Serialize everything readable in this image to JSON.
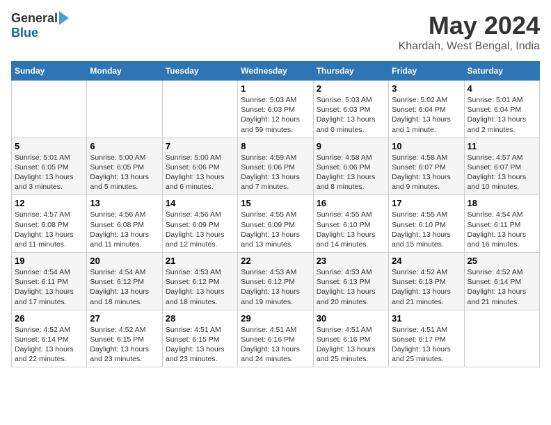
{
  "logo": {
    "general": "General",
    "blue": "Blue"
  },
  "title": {
    "month_year": "May 2024",
    "location": "Khardah, West Bengal, India"
  },
  "headers": [
    "Sunday",
    "Monday",
    "Tuesday",
    "Wednesday",
    "Thursday",
    "Friday",
    "Saturday"
  ],
  "weeks": [
    [
      {
        "day": "",
        "sunrise": "",
        "sunset": "",
        "daylight": ""
      },
      {
        "day": "",
        "sunrise": "",
        "sunset": "",
        "daylight": ""
      },
      {
        "day": "",
        "sunrise": "",
        "sunset": "",
        "daylight": ""
      },
      {
        "day": "1",
        "sunrise": "Sunrise: 5:03 AM",
        "sunset": "Sunset: 6:03 PM",
        "daylight": "Daylight: 12 hours and 59 minutes."
      },
      {
        "day": "2",
        "sunrise": "Sunrise: 5:03 AM",
        "sunset": "Sunset: 6:03 PM",
        "daylight": "Daylight: 13 hours and 0 minutes."
      },
      {
        "day": "3",
        "sunrise": "Sunrise: 5:02 AM",
        "sunset": "Sunset: 6:04 PM",
        "daylight": "Daylight: 13 hours and 1 minute."
      },
      {
        "day": "4",
        "sunrise": "Sunrise: 5:01 AM",
        "sunset": "Sunset: 6:04 PM",
        "daylight": "Daylight: 13 hours and 2 minutes."
      }
    ],
    [
      {
        "day": "5",
        "sunrise": "Sunrise: 5:01 AM",
        "sunset": "Sunset: 6:05 PM",
        "daylight": "Daylight: 13 hours and 3 minutes."
      },
      {
        "day": "6",
        "sunrise": "Sunrise: 5:00 AM",
        "sunset": "Sunset: 6:05 PM",
        "daylight": "Daylight: 13 hours and 5 minutes."
      },
      {
        "day": "7",
        "sunrise": "Sunrise: 5:00 AM",
        "sunset": "Sunset: 6:06 PM",
        "daylight": "Daylight: 13 hours and 6 minutes."
      },
      {
        "day": "8",
        "sunrise": "Sunrise: 4:59 AM",
        "sunset": "Sunset: 6:06 PM",
        "daylight": "Daylight: 13 hours and 7 minutes."
      },
      {
        "day": "9",
        "sunrise": "Sunrise: 4:58 AM",
        "sunset": "Sunset: 6:06 PM",
        "daylight": "Daylight: 13 hours and 8 minutes."
      },
      {
        "day": "10",
        "sunrise": "Sunrise: 4:58 AM",
        "sunset": "Sunset: 6:07 PM",
        "daylight": "Daylight: 13 hours and 9 minutes."
      },
      {
        "day": "11",
        "sunrise": "Sunrise: 4:57 AM",
        "sunset": "Sunset: 6:07 PM",
        "daylight": "Daylight: 13 hours and 10 minutes."
      }
    ],
    [
      {
        "day": "12",
        "sunrise": "Sunrise: 4:57 AM",
        "sunset": "Sunset: 6:08 PM",
        "daylight": "Daylight: 13 hours and 11 minutes."
      },
      {
        "day": "13",
        "sunrise": "Sunrise: 4:56 AM",
        "sunset": "Sunset: 6:08 PM",
        "daylight": "Daylight: 13 hours and 11 minutes."
      },
      {
        "day": "14",
        "sunrise": "Sunrise: 4:56 AM",
        "sunset": "Sunset: 6:09 PM",
        "daylight": "Daylight: 13 hours and 12 minutes."
      },
      {
        "day": "15",
        "sunrise": "Sunrise: 4:55 AM",
        "sunset": "Sunset: 6:09 PM",
        "daylight": "Daylight: 13 hours and 13 minutes."
      },
      {
        "day": "16",
        "sunrise": "Sunrise: 4:55 AM",
        "sunset": "Sunset: 6:10 PM",
        "daylight": "Daylight: 13 hours and 14 minutes."
      },
      {
        "day": "17",
        "sunrise": "Sunrise: 4:55 AM",
        "sunset": "Sunset: 6:10 PM",
        "daylight": "Daylight: 13 hours and 15 minutes."
      },
      {
        "day": "18",
        "sunrise": "Sunrise: 4:54 AM",
        "sunset": "Sunset: 6:11 PM",
        "daylight": "Daylight: 13 hours and 16 minutes."
      }
    ],
    [
      {
        "day": "19",
        "sunrise": "Sunrise: 4:54 AM",
        "sunset": "Sunset: 6:11 PM",
        "daylight": "Daylight: 13 hours and 17 minutes."
      },
      {
        "day": "20",
        "sunrise": "Sunrise: 4:54 AM",
        "sunset": "Sunset: 6:12 PM",
        "daylight": "Daylight: 13 hours and 18 minutes."
      },
      {
        "day": "21",
        "sunrise": "Sunrise: 4:53 AM",
        "sunset": "Sunset: 6:12 PM",
        "daylight": "Daylight: 13 hours and 18 minutes."
      },
      {
        "day": "22",
        "sunrise": "Sunrise: 4:53 AM",
        "sunset": "Sunset: 6:12 PM",
        "daylight": "Daylight: 13 hours and 19 minutes."
      },
      {
        "day": "23",
        "sunrise": "Sunrise: 4:53 AM",
        "sunset": "Sunset: 6:13 PM",
        "daylight": "Daylight: 13 hours and 20 minutes."
      },
      {
        "day": "24",
        "sunrise": "Sunrise: 4:52 AM",
        "sunset": "Sunset: 6:13 PM",
        "daylight": "Daylight: 13 hours and 21 minutes."
      },
      {
        "day": "25",
        "sunrise": "Sunrise: 4:52 AM",
        "sunset": "Sunset: 6:14 PM",
        "daylight": "Daylight: 13 hours and 21 minutes."
      }
    ],
    [
      {
        "day": "26",
        "sunrise": "Sunrise: 4:52 AM",
        "sunset": "Sunset: 6:14 PM",
        "daylight": "Daylight: 13 hours and 22 minutes."
      },
      {
        "day": "27",
        "sunrise": "Sunrise: 4:52 AM",
        "sunset": "Sunset: 6:15 PM",
        "daylight": "Daylight: 13 hours and 23 minutes."
      },
      {
        "day": "28",
        "sunrise": "Sunrise: 4:51 AM",
        "sunset": "Sunset: 6:15 PM",
        "daylight": "Daylight: 13 hours and 23 minutes."
      },
      {
        "day": "29",
        "sunrise": "Sunrise: 4:51 AM",
        "sunset": "Sunset: 6:16 PM",
        "daylight": "Daylight: 13 hours and 24 minutes."
      },
      {
        "day": "30",
        "sunrise": "Sunrise: 4:51 AM",
        "sunset": "Sunset: 6:16 PM",
        "daylight": "Daylight: 13 hours and 25 minutes."
      },
      {
        "day": "31",
        "sunrise": "Sunrise: 4:51 AM",
        "sunset": "Sunset: 6:17 PM",
        "daylight": "Daylight: 13 hours and 25 minutes."
      },
      {
        "day": "",
        "sunrise": "",
        "sunset": "",
        "daylight": ""
      }
    ]
  ]
}
